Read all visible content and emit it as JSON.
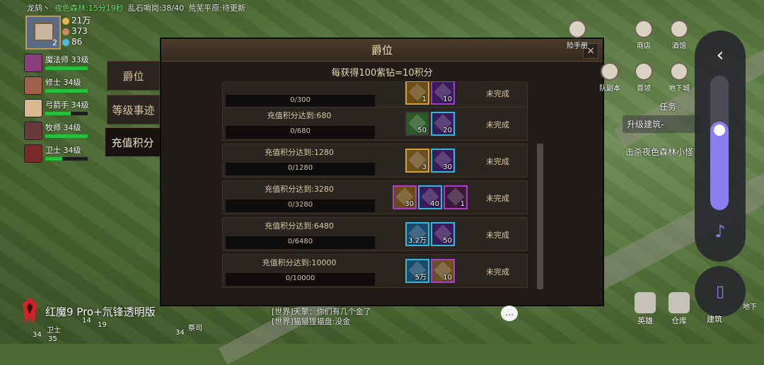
{
  "topbar": {
    "player_name": "龙鸫丶",
    "zone_timer": "夜色森林:15分19秒",
    "chaos_camp": "乱石哨岗:38/40",
    "wild_plain": "荒芜平原:待更新"
  },
  "player": {
    "level": "2",
    "resources": [
      {
        "value": "21万",
        "color": "#e8b64a"
      },
      {
        "value": "373",
        "color": "#c98a5a"
      },
      {
        "value": "86",
        "color": "#4fb8e8"
      }
    ]
  },
  "heroes": [
    {
      "name": "魔法师",
      "level": "33级",
      "hp": 1.0,
      "color": "#8a3f7a"
    },
    {
      "name": "修士",
      "level": "34级",
      "hp": 1.0,
      "color": "#a0604a"
    },
    {
      "name": "弓箭手",
      "level": "34级",
      "hp": 0.6,
      "color": "#d8b890"
    },
    {
      "name": "牧师",
      "level": "34级",
      "hp": 1.0,
      "color": "#6a3a3a"
    },
    {
      "name": "卫士",
      "level": "34级",
      "hp": 0.4,
      "color": "#7a2a2a"
    }
  ],
  "tabs": {
    "rank": "爵位",
    "level_events": "等级事迹",
    "recharge_points": "充值积分"
  },
  "modal": {
    "title": "爵位",
    "close": "×",
    "subtitle": "每获得100紫钻=10积分"
  },
  "rows": [
    {
      "goal": "",
      "progress": "0/300",
      "status": "未完成",
      "items": [
        {
          "count": "1",
          "color": "#d8a030",
          "fill": "#6a4c18"
        },
        {
          "count": "10",
          "color": "#a03ad0",
          "fill": "#3a1a5a"
        }
      ]
    },
    {
      "goal": "充值积分达到:680",
      "progress": "0/680",
      "status": "未完成",
      "items": [
        {
          "count": "50",
          "color": "#3a3a3a",
          "fill": "#2d5a25"
        },
        {
          "count": "20",
          "color": "#30b8e0",
          "fill": "#3a1a5a"
        }
      ]
    },
    {
      "goal": "充值积分达到:1280",
      "progress": "0/1280",
      "status": "未完成",
      "items": [
        {
          "count": "3",
          "color": "#d8a030",
          "fill": "#6a5020"
        },
        {
          "count": "30",
          "color": "#30b8e0",
          "fill": "#3a1a5a"
        }
      ]
    },
    {
      "goal": "充值积分达到:3280",
      "progress": "0/3280",
      "status": "未完成",
      "items": [
        {
          "count": "30",
          "color": "#b03ad0",
          "fill": "#6a4a18"
        },
        {
          "count": "40",
          "color": "#30b8e0",
          "fill": "#3a1a5a"
        },
        {
          "count": "1",
          "color": "#b03ad0",
          "fill": "#3a1a3a"
        }
      ]
    },
    {
      "goal": "充值积分达到:6480",
      "progress": "0/6480",
      "status": "未完成",
      "items": [
        {
          "count": "3.2万",
          "color": "#30b8e0",
          "fill": "#1a4a6a"
        },
        {
          "count": "50",
          "color": "#30b8e0",
          "fill": "#3a1a5a"
        }
      ]
    },
    {
      "goal": "充值积分达到:10000",
      "progress": "0/10000",
      "status": "未完成",
      "items": [
        {
          "count": "5万",
          "color": "#30b8e0",
          "fill": "#1a4a6a"
        },
        {
          "count": "10",
          "color": "#b03ad0",
          "fill": "#6a5020"
        }
      ]
    }
  ],
  "right_menu": [
    {
      "label": "险手册"
    },
    {
      "label": "商店"
    },
    {
      "label": "酒馆"
    },
    {
      "label": "队副本"
    },
    {
      "label": "首领"
    },
    {
      "label": "地下城"
    }
  ],
  "task": {
    "header": "任务",
    "button": "升级建筑-",
    "kill": "击杀夜色森林小怪"
  },
  "bottom": {
    "hero": "英雄",
    "warehouse": "仓库",
    "build": "建筑",
    "underground": "地下"
  },
  "sidepanel": {
    "back": "‹",
    "volume": 0.45,
    "music": "♪",
    "vibrate": "▯"
  },
  "chat": [
    "[世界]天擎：你们有几个金了",
    "[世界]猫猫狸猫盘:没金"
  ],
  "chat_icon": "…",
  "watermark": "红魔9 Pro+氘锋透明版",
  "units": [
    {
      "label": "卫士"
    },
    {
      "label": "祭司"
    },
    {
      "label": "34"
    },
    {
      "label": "35"
    },
    {
      "label": "19"
    },
    {
      "label": "14"
    },
    {
      "label": "34"
    }
  ]
}
